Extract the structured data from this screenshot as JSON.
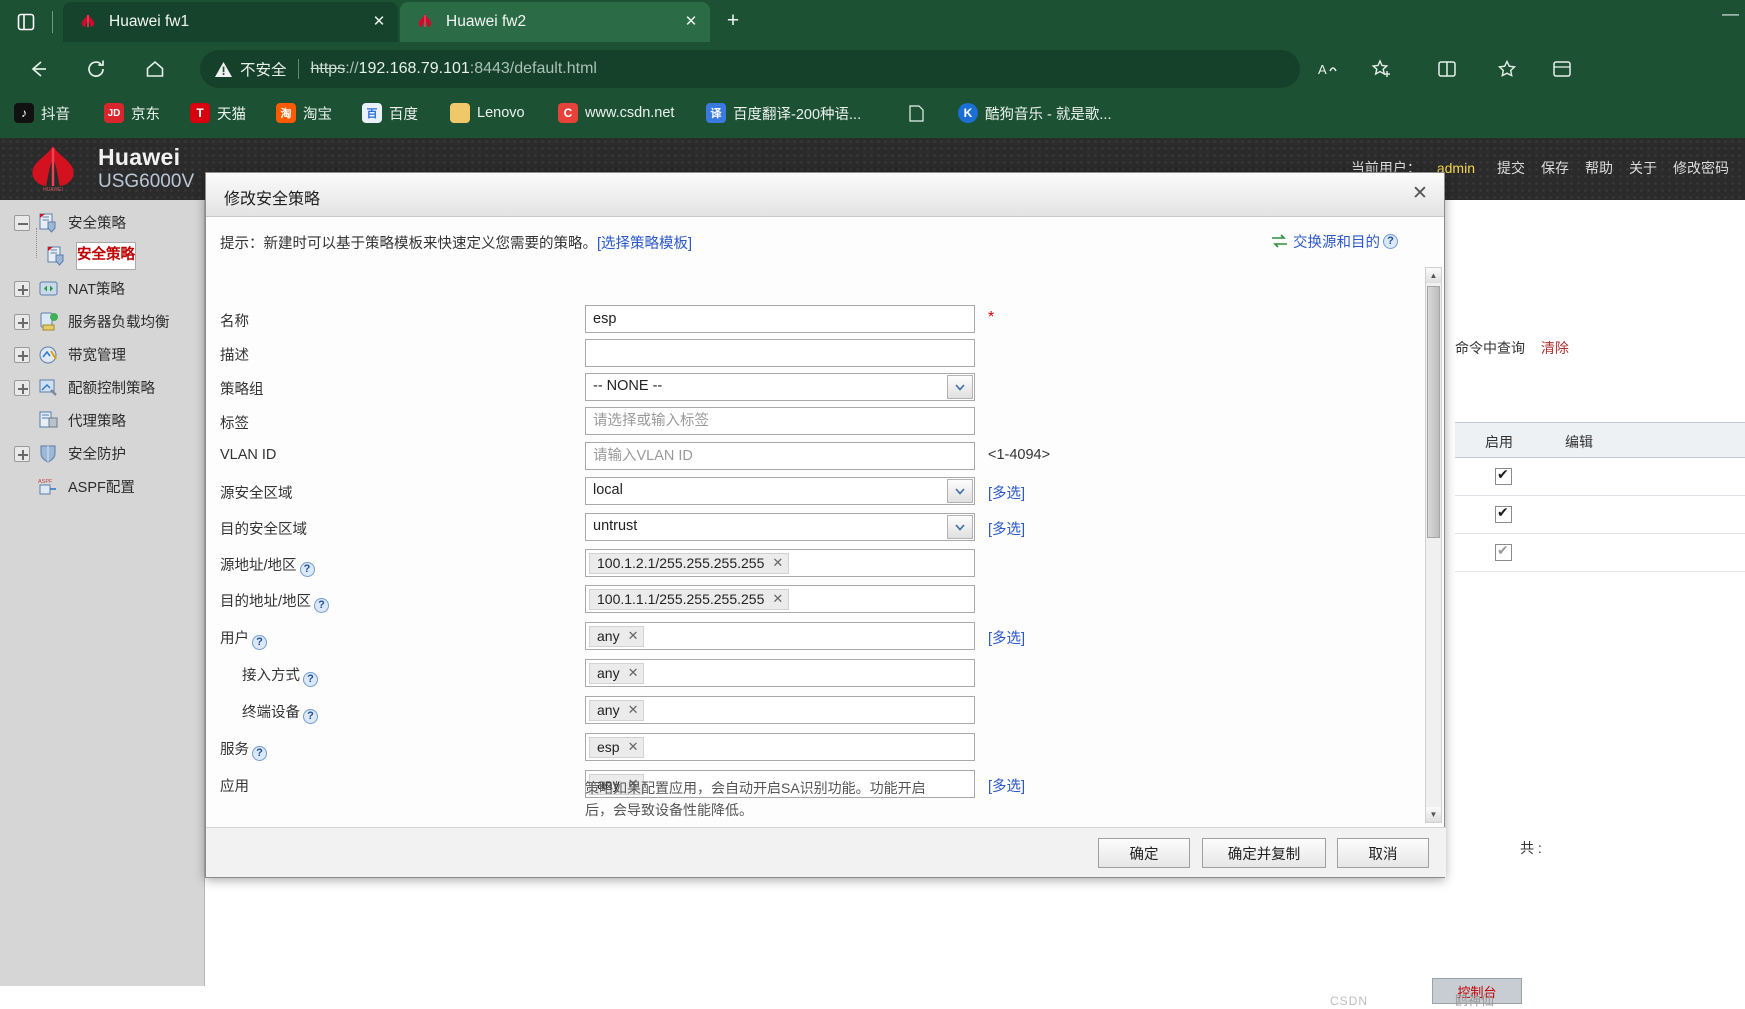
{
  "browser": {
    "tab_controls_icon": "tab-list-icon",
    "new_tab_label": "+",
    "minimize_label": "—",
    "tabs": [
      {
        "title": "Huawei fw1",
        "close": "✕",
        "active": false
      },
      {
        "title": "Huawei fw2",
        "close": "✕",
        "active": true
      }
    ],
    "nav": {
      "back_icon": "back-arrow-icon",
      "reload_icon": "reload-icon",
      "home_icon": "home-icon",
      "read_aloud_icon": "read-aloud-icon",
      "favorite_icon": "add-favorite-icon",
      "split_icon": "split-screen-icon",
      "collections_icon": "collections-icon",
      "profile_icon": "browser-essentials-icon"
    },
    "omnibox": {
      "security_label": "不安全",
      "security_icon": "warning-triangle-icon",
      "url_scheme": "https",
      "url_sep": "://",
      "url_host": "192.168.79.101",
      "url_rest": ":8443/default.html"
    },
    "bookmarks": [
      {
        "label": "抖音",
        "icon": "douyin-icon",
        "bg": "#111111",
        "glyph": "♪"
      },
      {
        "label": "京东",
        "icon": "jd-icon",
        "bg": "#d9262c",
        "glyph": "JD"
      },
      {
        "label": "天猫",
        "icon": "tmall-icon",
        "bg": "#d8000f",
        "glyph": "T"
      },
      {
        "label": "淘宝",
        "icon": "taobao-icon",
        "bg": "#ff5a00",
        "glyph": "淘"
      },
      {
        "label": "百度",
        "icon": "baidu-icon",
        "bg": "#eaf1fb",
        "glyph": "百"
      },
      {
        "label": "Lenovo",
        "icon": "folder-icon",
        "bg": "#f0c86a",
        "glyph": ""
      },
      {
        "label": "www.csdn.net",
        "icon": "csdn-icon",
        "bg": "#e8413a",
        "glyph": "C"
      },
      {
        "label": "百度翻译-200种语...",
        "icon": "translate-icon",
        "bg": "#3a7ae0",
        "glyph": "译"
      },
      {
        "label": "",
        "icon": "page-icon",
        "bg": "transparent",
        "glyph": ""
      },
      {
        "label": "酷狗音乐 - 就是歌...",
        "icon": "kugou-icon",
        "bg": "#1a6fd4",
        "glyph": "K"
      }
    ]
  },
  "device_header": {
    "brand": "Huawei",
    "model": "USG6000V",
    "current_user_label": "当前用户：",
    "current_user": "admin",
    "actions": [
      "提交",
      "保存",
      "帮助",
      "关于",
      "修改密码"
    ]
  },
  "sidebar": {
    "items": [
      {
        "label": "安全策略",
        "toggle": "minus",
        "icon": "policy-icon",
        "selected": false,
        "indent": 0
      },
      {
        "label": "安全策略",
        "toggle": "none",
        "icon": "policy-icon",
        "selected": true,
        "indent": 1
      },
      {
        "label": "NAT策略",
        "toggle": "plus",
        "icon": "nat-icon",
        "selected": false,
        "indent": 0
      },
      {
        "label": "服务器负载均衡",
        "toggle": "plus",
        "icon": "slb-icon",
        "selected": false,
        "indent": 0
      },
      {
        "label": "带宽管理",
        "toggle": "plus",
        "icon": "bandwidth-icon",
        "selected": false,
        "indent": 0
      },
      {
        "label": "配额控制策略",
        "toggle": "plus",
        "icon": "quota-icon",
        "selected": false,
        "indent": 0
      },
      {
        "label": "代理策略",
        "toggle": "none",
        "icon": "proxy-icon",
        "selected": false,
        "indent": 0
      },
      {
        "label": "安全防护",
        "toggle": "plus",
        "icon": "shield-icon",
        "selected": false,
        "indent": 0
      },
      {
        "label": "ASPF配置",
        "toggle": "none",
        "icon": "aspf-icon",
        "selected": false,
        "indent": 0
      }
    ]
  },
  "background_page": {
    "toolbar_query": "命令中查询",
    "toolbar_clear": "清除",
    "grid_headers": [
      "启用",
      "编辑"
    ],
    "rows_count": 3,
    "total_label": "共 :",
    "console_label": "控制台",
    "watermark": "鸥神仙"
  },
  "dialog": {
    "title": "修改安全策略",
    "close_icon": "✕",
    "tip_prefix": "提示：新建时可以基于策略模板来快速定义您需要的策略。",
    "tip_link": "[选择策略模板]",
    "swap_label": "交换源和目的",
    "swap_icon": "swap-arrows-icon",
    "fields": [
      {
        "label": "名称",
        "type": "input",
        "value": "esp",
        "placeholder": "",
        "required": true,
        "side": ""
      },
      {
        "label": "描述",
        "type": "input",
        "value": "",
        "placeholder": "",
        "required": false,
        "side": ""
      },
      {
        "label": "策略组",
        "type": "select",
        "value": "-- NONE --",
        "placeholder": "",
        "required": false,
        "side": ""
      },
      {
        "label": "标签",
        "type": "input",
        "value": "",
        "placeholder": "请选择或输入标签",
        "required": false,
        "side": ""
      },
      {
        "label": "VLAN ID",
        "type": "input",
        "value": "",
        "placeholder": "请输入VLAN ID",
        "required": false,
        "side": "<1-4094>"
      },
      {
        "label": "源安全区域",
        "type": "select",
        "value": "local",
        "placeholder": "",
        "required": false,
        "side": "[多选]"
      },
      {
        "label": "目的安全区域",
        "type": "select",
        "value": "untrust",
        "placeholder": "",
        "required": false,
        "side": "[多选]"
      },
      {
        "label": "源地址/地区",
        "type": "tags",
        "tags": [
          "100.1.2.1/255.255.255.255"
        ],
        "help": true,
        "side": ""
      },
      {
        "label": "目的地址/地区",
        "type": "tags",
        "tags": [
          "100.1.1.1/255.255.255.255"
        ],
        "help": true,
        "side": ""
      },
      {
        "label": "用户",
        "type": "tags",
        "tags": [
          "any"
        ],
        "help": true,
        "side": "[多选]"
      },
      {
        "label": "接入方式",
        "type": "tags",
        "tags": [
          "any"
        ],
        "help": true,
        "side": "",
        "indent": true
      },
      {
        "label": "终端设备",
        "type": "tags",
        "tags": [
          "any"
        ],
        "help": true,
        "side": "",
        "indent": true
      },
      {
        "label": "服务",
        "type": "tags",
        "tags": [
          "esp"
        ],
        "help": true,
        "side": ""
      },
      {
        "label": "应用",
        "type": "tags",
        "tags": [
          "any"
        ],
        "help": false,
        "side": "[多选]"
      }
    ],
    "note_line1": "策略如果配置应用，会自动开启SA识别功能。功能开启",
    "note_line2": "后，会导致设备性能降低。",
    "buttons": [
      {
        "label": "确定"
      },
      {
        "label": "确定并复制"
      },
      {
        "label": "取消"
      }
    ],
    "scroll": {
      "up": "▲",
      "down": "▼"
    }
  }
}
